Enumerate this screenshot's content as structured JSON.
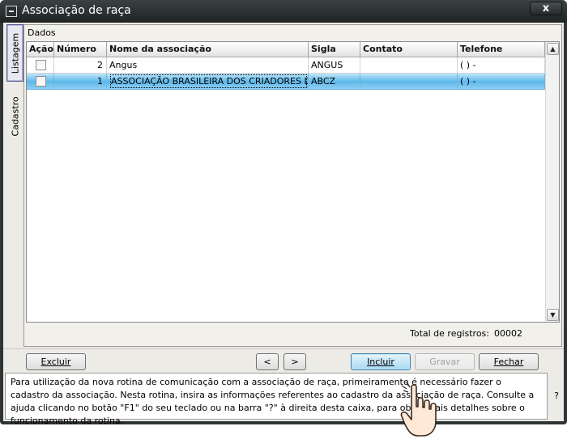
{
  "window": {
    "title": "Associação de raça",
    "close_label": "x"
  },
  "tabs": [
    {
      "label": "Listagem",
      "active": true
    },
    {
      "label": "Cadastro",
      "active": false
    }
  ],
  "panel": {
    "label": "Dados"
  },
  "grid": {
    "columns": [
      "Ação",
      "Número",
      "Nome da associação",
      "Sigla",
      "Contato",
      "Telefone"
    ],
    "rows": [
      {
        "numero": "2",
        "nome": "Angus",
        "sigla": "ANGUS",
        "contato": "",
        "telefone": "(  )    -",
        "selected": false
      },
      {
        "numero": "1",
        "nome": "ASSOCIAÇÃO BRASILEIRA DOS CRIADORES DE ZEBU",
        "sigla": "ABCZ",
        "contato": "",
        "telefone": "(  )    -",
        "selected": true
      }
    ]
  },
  "total": {
    "label": "Total de registros:",
    "value": "00002"
  },
  "buttons": {
    "excluir": "Excluir",
    "prev": "<",
    "next": ">",
    "incluir": "Incluir",
    "gravar": "Gravar",
    "fechar": "Fechar"
  },
  "help": {
    "text": "Para utilização da nova rotina de comunicação com a associação de raça, primeiramente é necessário fazer o cadastro da associação. Nesta rotina, insira as informações referentes ao cadastro da associação de raça. Consulte a ajuda clicando no botão \"F1\" do seu teclado ou na barra \"?\" à direita desta caixa, para obter mais detalhes sobre o funcionamento da rotina.",
    "question_mark": "?"
  },
  "colors": {
    "selection": "#5db8ea",
    "titlebar": "#2f3436",
    "primary_button": "#a7d9f5"
  },
  "icons": [
    "system-menu-icon",
    "close-icon",
    "scroll-up-icon",
    "scroll-down-icon",
    "hand-pointer-icon"
  ]
}
